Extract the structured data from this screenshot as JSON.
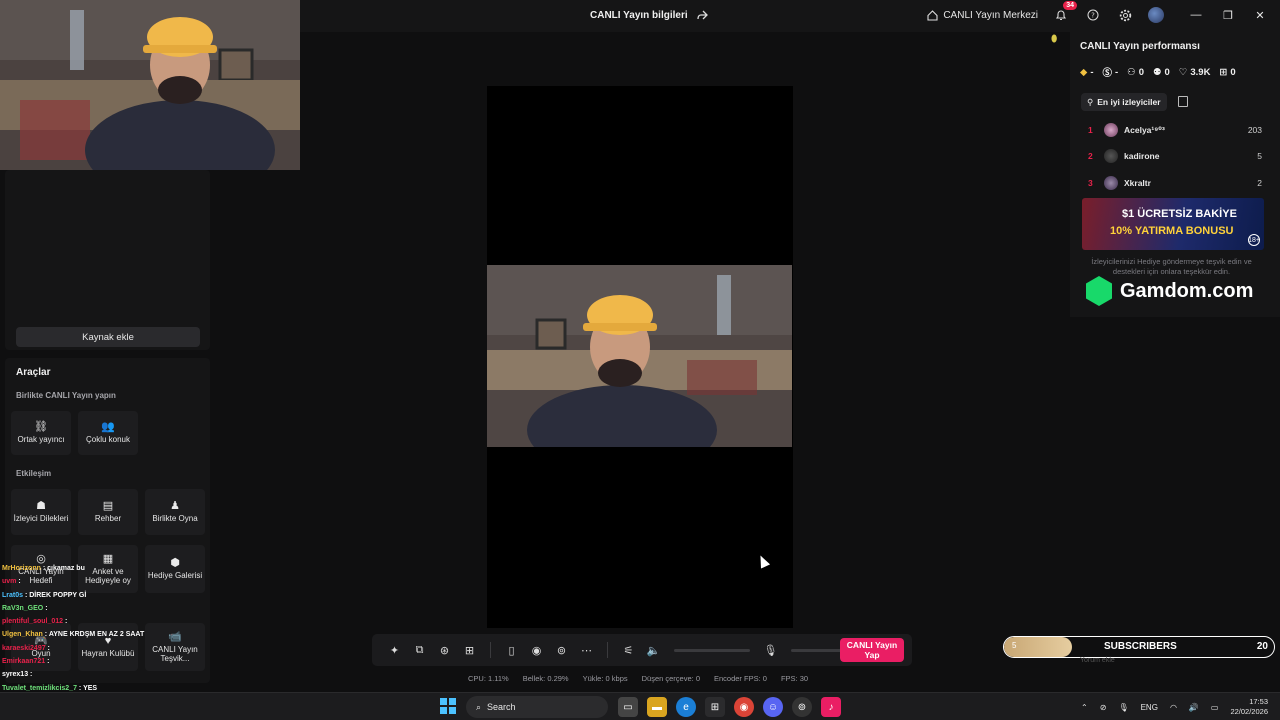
{
  "titlebar": {
    "title": "CANLI Yayın bilgileri",
    "home_label": "CANLI Yayın Merkezi",
    "notification_count": "34"
  },
  "left_panel": {
    "add_source_label": "Kaynak ekle",
    "tools_title": "Araçlar",
    "together_section": "Birlikte CANLI Yayın yapın",
    "together_tools": [
      {
        "label": "Ortak yayıncı",
        "icon": "link-icon"
      },
      {
        "label": "Çoklu konuk",
        "icon": "users-icon"
      }
    ],
    "interaction_section": "Etkileşim",
    "interaction_tools": [
      {
        "label": "İzleyici Dilekleri",
        "icon": "viewer-requests-icon"
      },
      {
        "label": "Rehber",
        "icon": "guide-icon"
      },
      {
        "label": "Birlikte Oyna",
        "icon": "play-together-icon"
      },
      {
        "label": "CANLI Yayın Hedefi",
        "icon": "target-icon"
      },
      {
        "label": "Anket ve Hediyeyle oy",
        "icon": "poll-icon"
      },
      {
        "label": "Hediye Galerisi",
        "icon": "gift-gallery-icon"
      },
      {
        "label": "Oyun",
        "icon": "game-icon"
      },
      {
        "label": "Hayran Kulübü",
        "icon": "fan-club-icon"
      },
      {
        "label": "CANLI Yayın Teşvik...",
        "icon": "camera-icon"
      }
    ]
  },
  "chat": [
    {
      "user": "MrHorizonn",
      "msg": "çıkamaz bu",
      "color": "#f0c040"
    },
    {
      "user": "uvm",
      "msg": "",
      "color": "#e8224b"
    },
    {
      "user": "Lrat0s",
      "msg": "DİREK POPPY Gİ",
      "color": "#4cc2ff"
    },
    {
      "user": "RaV3n_GEO",
      "msg": "",
      "color": "#6ee07a"
    },
    {
      "user": "plentiful_soul_012",
      "msg": "",
      "color": "#e8224b"
    },
    {
      "user": "Ulgen_Khan",
      "msg": "AYNE KRDŞM EN AZ 2 SAAT",
      "color": "#f0c040"
    },
    {
      "user": "karaeski2497",
      "msg": "",
      "color": "#e8224b"
    },
    {
      "user": "Emirkaan721",
      "msg": "",
      "color": "#e8224b"
    },
    {
      "user": "syrex13",
      "msg": "",
      "color": "#ffffff"
    },
    {
      "user": "Tuvalet_temizlikcis2_7",
      "msg": "YES",
      "color": "#6ee07a"
    }
  ],
  "toolbar": {
    "go_live_label": "CANLI Yayın Yap",
    "icons": [
      "magic-wand-icon",
      "effects-icon",
      "ai-icon",
      "layout-icon",
      "phone-icon",
      "record-icon",
      "capture-icon",
      "more-icon",
      "settings-sliders-icon",
      "volume-icon",
      "microphone-icon"
    ]
  },
  "stats": {
    "cpu": "CPU: 1.11%",
    "memory": "Bellek: 0.29%",
    "upload": "Yükle: 0 kbps",
    "dropped": "Düşen çerçeve: 0",
    "encoder_fps": "Encoder FPS: 0",
    "fps": "FPS: 30"
  },
  "right_panel": {
    "title": "CANLI Yayın performansı",
    "metrics": [
      {
        "icon": "diamond-icon",
        "value": "-"
      },
      {
        "icon": "coin-icon",
        "value": "-"
      },
      {
        "icon": "followers-icon",
        "value": "0"
      },
      {
        "icon": "shares-icon",
        "value": "0"
      },
      {
        "icon": "heart-icon",
        "value": "3.9K"
      },
      {
        "icon": "gift-icon",
        "value": "0"
      }
    ],
    "top_viewers_label": "En iyi izleyiciler",
    "viewers": [
      {
        "rank": "1",
        "name": "Acelya¹⁹⁰³",
        "score": "203"
      },
      {
        "rank": "2",
        "name": "kadirone",
        "score": "5"
      },
      {
        "rank": "3",
        "name": "Xkraltr",
        "score": "2"
      }
    ],
    "promo_line1": "$1 ÜCRETSİZ BAKİYE",
    "promo_line2": "10% YATIRMA BONUSU",
    "promo_age": "18+",
    "promo_text": "İzleyicilerinizi Hediye göndermeye teşvik edin ve destekleri için onlara teşekkür edin.",
    "gamdom_label": "Gamdom.com"
  },
  "subscribers": {
    "left": "5",
    "label": "SUBSCRIBERS",
    "right": "20",
    "progress": 0.25,
    "comment_placeholder": "Yorum ekle"
  },
  "taskbar": {
    "search_label": "Search",
    "language": "ENG",
    "time": "17:53",
    "date": "22/02/2026"
  }
}
